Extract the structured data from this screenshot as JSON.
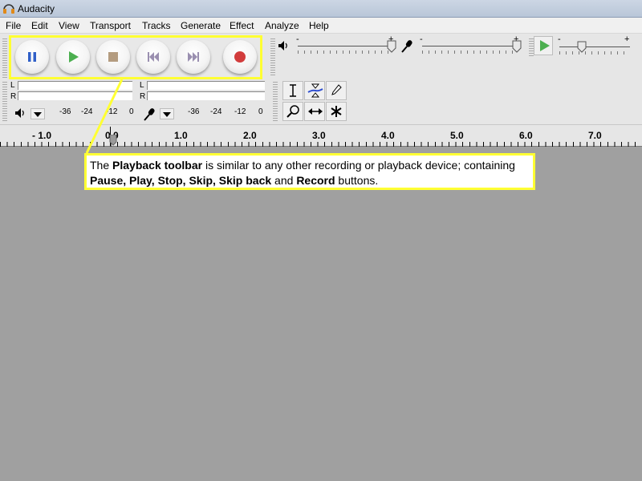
{
  "window": {
    "title": "Audacity"
  },
  "menu": [
    "File",
    "Edit",
    "View",
    "Transport",
    "Tracks",
    "Generate",
    "Effect",
    "Analyze",
    "Help"
  ],
  "transport": {
    "buttons": [
      "pause-icon",
      "play-icon",
      "stop-icon",
      "skip-to-start-icon",
      "skip-to-end-icon",
      "record-icon"
    ]
  },
  "mixer": {
    "minus": "-",
    "plus": "+"
  },
  "playback_speed": {
    "minus": "-",
    "plus": "+"
  },
  "meters": {
    "left_label": "L",
    "right_label": "R",
    "playback_scale": [
      "-36",
      "-24",
      "-12",
      "0"
    ],
    "record_scale": [
      "-36",
      "-24",
      "-12",
      "0"
    ]
  },
  "ruler": {
    "labels": [
      "- 1.0",
      "0.0",
      "1.0",
      "2.0",
      "3.0",
      "4.0",
      "5.0",
      "6.0",
      "7.0"
    ]
  },
  "callout": {
    "p1": "The ",
    "b1": "Playback toolbar",
    "p2": " is similar to any other recording or playback device; containing ",
    "b2": "Pause, Play, Stop, Skip, Skip back",
    "p3": " and ",
    "b3": "Record",
    "p4": " buttons."
  },
  "colors": {
    "highlight": "#ffff33",
    "play": "#4caf50",
    "record": "#d23c3c",
    "pause": "#3060c8",
    "workspace": "#a0a0a0"
  }
}
